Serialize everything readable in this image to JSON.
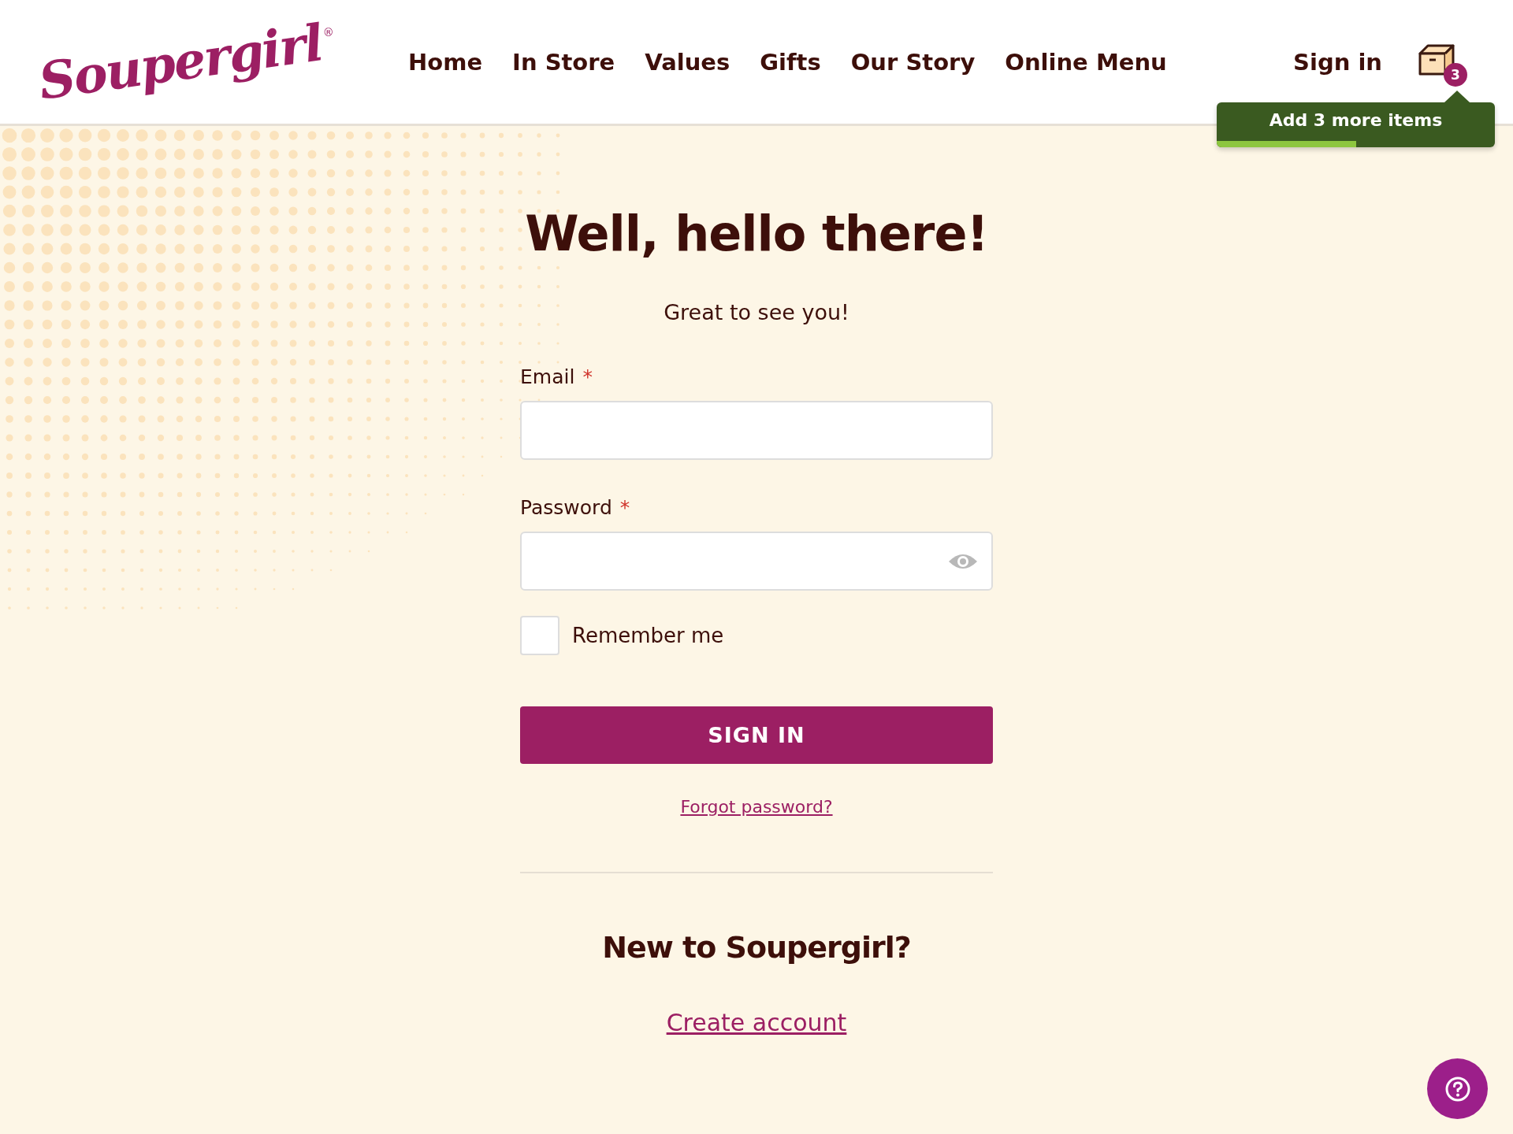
{
  "header": {
    "logo": {
      "text": "Soupergirl",
      "mark": "®"
    },
    "nav": [
      {
        "label": "Home"
      },
      {
        "label": "In Store"
      },
      {
        "label": "Values"
      },
      {
        "label": "Gifts"
      },
      {
        "label": "Our Story"
      },
      {
        "label": "Online Menu"
      }
    ],
    "sign_in": "Sign in",
    "cart": {
      "count": "3"
    },
    "cart_tooltip": {
      "text": "Add 3 more items",
      "level": 0.5
    }
  },
  "form": {
    "title": "Well, hello there!",
    "subtitle": "Great to see you!",
    "fields": [
      {
        "label": "Email",
        "required_mark": "*",
        "kind": "text"
      },
      {
        "label": "Password",
        "required_mark": "*",
        "kind": "password"
      }
    ],
    "remember": {
      "label": "Remember me",
      "checked": false
    },
    "submit": "SIGN IN",
    "forgot": "Forgot password?",
    "new_title": "New to Soupergirl?",
    "create": "Create account"
  }
}
